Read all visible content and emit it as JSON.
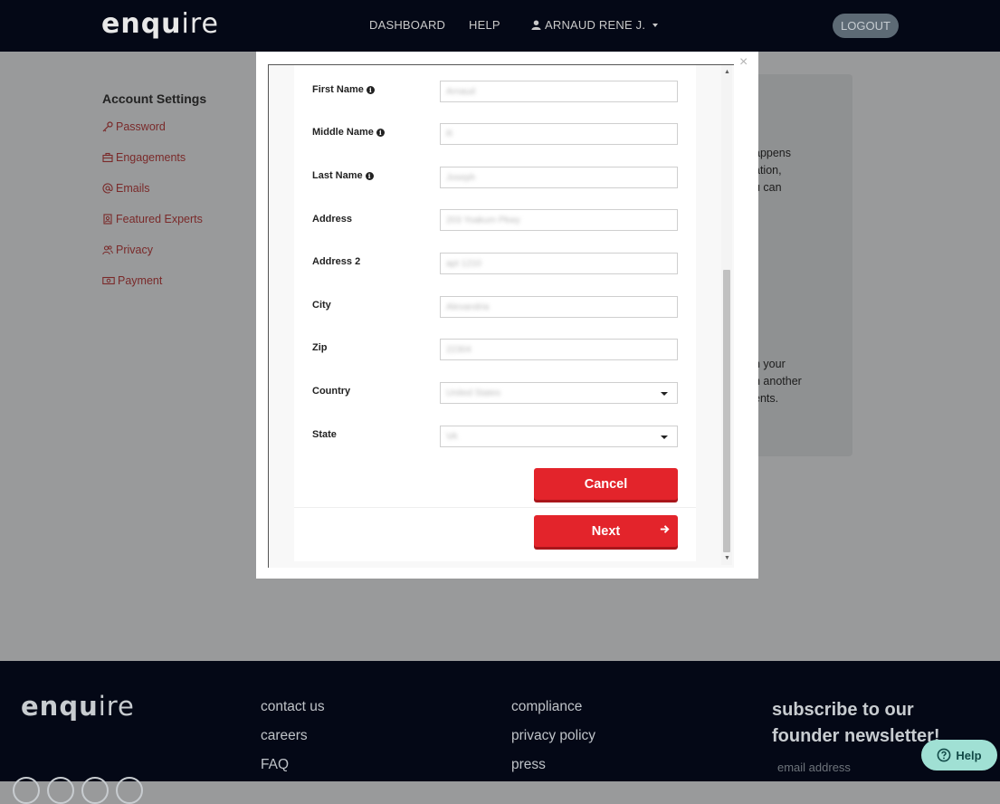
{
  "header": {
    "logo_bold": "enqu",
    "logo_thin": "ire",
    "nav": {
      "dashboard": "DASHBOARD",
      "help": "HELP",
      "user": "ARNAUD RENE J."
    },
    "logout": "LOGOUT"
  },
  "sidebar": {
    "title": "Account Settings",
    "items": [
      {
        "label": "Password",
        "icon": "key-icon"
      },
      {
        "label": "Engagements",
        "icon": "briefcase-icon"
      },
      {
        "label": "Emails",
        "icon": "at-icon"
      },
      {
        "label": "Featured Experts",
        "icon": "badge-icon"
      },
      {
        "label": "Privacy",
        "icon": "users-icon"
      },
      {
        "label": "Payment",
        "icon": "money-icon"
      }
    ]
  },
  "right_panel": {
    "lines_top": [
      "appens",
      "ation,",
      "u can"
    ],
    "lines_bottom": [
      "n your",
      "h another",
      "ents."
    ]
  },
  "modal": {
    "close": "×",
    "fields": [
      {
        "label": "First Name",
        "value": "Arnaud",
        "info": true
      },
      {
        "label": "Middle Name",
        "value": "R",
        "info": true
      },
      {
        "label": "Last Name",
        "value": "Joseph",
        "info": true
      },
      {
        "label": "Address",
        "value": "203 Yoakum Pkwy"
      },
      {
        "label": "Address 2",
        "value": "apt 1210"
      },
      {
        "label": "City",
        "value": "Alexandria"
      },
      {
        "label": "Zip",
        "value": "22304"
      },
      {
        "label": "Country",
        "value": "United States",
        "select": true
      },
      {
        "label": "State",
        "value": "VA",
        "select": true
      }
    ],
    "cancel": "Cancel",
    "next": "Next"
  },
  "footer": {
    "logo_bold": "enqu",
    "logo_thin": "ire",
    "col1": [
      "contact us",
      "careers",
      "FAQ"
    ],
    "col2": [
      "compliance",
      "privacy policy",
      "press"
    ],
    "subscribe": "subscribe to our founder newsletter!",
    "email_placeholder": "email address"
  },
  "help_widget": "Help"
}
